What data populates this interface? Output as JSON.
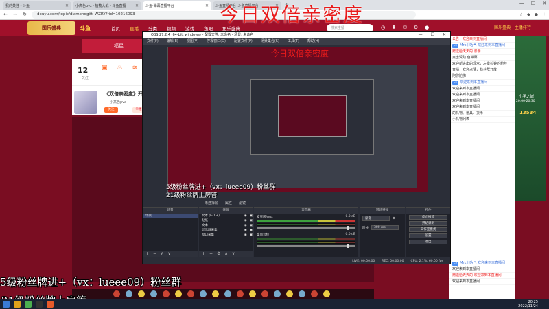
{
  "browser": {
    "tabs": [
      {
        "title": "我的关注 - 斗鱼",
        "active": false
      },
      {
        "title": "小高色pvz · 植物大战 - 斗鱼直播",
        "active": false
      },
      {
        "title": "斗鱼·弹幕直播平台",
        "active": true
      },
      {
        "title": "斗鱼直播平台_斗鱼直播平台",
        "active": false
      }
    ],
    "url": "douyu.com/topic/diamondgift_WZRY?rid=10216093",
    "window_controls": [
      "—",
      "☐",
      "✕"
    ]
  },
  "site": {
    "banner": "国乐盛典",
    "logo": "斗鱼",
    "nav": [
      "首页",
      "直播",
      "分类",
      "视频",
      "游戏",
      "鱼吧",
      "鱼乐盛典"
    ],
    "active_nav": "直播",
    "search_placeholder": "搜索主播"
  },
  "overlay": {
    "title": "今日双倍亲密度",
    "left_banner": "福星",
    "danmu_1": "5级粉丝牌进+（vx：lueee09）粉丝群",
    "danmu_2": "21级粉丝牌上房管"
  },
  "room": {
    "follow_count": "12",
    "follow_label": "关注",
    "title": "《双倍亲密度》开",
    "anchor": "小高色pvz",
    "btn_primary": "关注",
    "btn_secondary": "举报"
  },
  "obs": {
    "title": "OBS 27.2.4 (64-bit, windows) - 配置文件: 未命名 - 场景: 未命名",
    "menu": [
      "文件(F)",
      "编辑(E)",
      "视图(V)",
      "停靠窗口(D)",
      "配置文件(P)",
      "场景集合(S)",
      "工具(T)",
      "帮助(H)"
    ],
    "sub_title": "今日双倍亲密度",
    "danmu_1": "5级粉丝牌进+（vx：lueee09）粉丝群",
    "danmu_2": "21级粉丝牌上房管",
    "toolbar": [
      "未选择源",
      "属性",
      "滤镜"
    ],
    "docks": {
      "scenes": {
        "title": "场景",
        "items": [
          "场景"
        ]
      },
      "sources": {
        "title": "来源",
        "items": [
          "文本 (GDI+)",
          "贴纸",
          "文本",
          "显示器采集",
          "窗口采集"
        ]
      },
      "mixer": {
        "title": "混音器",
        "tracks": [
          {
            "name": "桌面音频",
            "level": "0.0 dB"
          },
          {
            "name": "麦克风/Aux",
            "level": "0.0 dB"
          }
        ]
      },
      "transitions": {
        "title": "转场特效",
        "type": "渐变",
        "duration_label": "时长",
        "duration": "300 ms"
      },
      "controls": {
        "title": "控件",
        "buttons": [
          "停止推流",
          "开始录制",
          "工作室模式",
          "设置",
          "退出"
        ]
      }
    },
    "status": [
      "LIVE: 00:00:00",
      "REC: 00:00:00",
      "CPU: 2.1%, 60.00 fps"
    ]
  },
  "right_panel": {
    "ad_top": "国乐盛典 · 主播排行",
    "ad_label": "小学之城",
    "ad_time": "20:00-20:30",
    "ad_number": "13534",
    "chat": [
      {
        "tag": "",
        "text": "公告：欢迎来到直播间",
        "style": "red"
      },
      {
        "tag": "Lv",
        "text": "Mrk丨咕气 欢迎来到本直播间",
        "style": "blu"
      },
      {
        "tag": "",
        "text": "赠送给天天的 亲亲",
        "style": "red"
      },
      {
        "tag": "",
        "text": "点击赞助 色弹幕",
        "style": ""
      },
      {
        "tag": "",
        "text": "欢迎新进出的观众，左键拉钟的粉丝",
        "style": ""
      },
      {
        "tag": "",
        "text": "直播，欢迎点赞，粉丝群开放",
        "style": ""
      },
      {
        "tag": "",
        "text": "阿弥陀佛",
        "style": ""
      },
      {
        "tag": "Lv",
        "text": "欢迎来到本直播间",
        "style": "blu"
      },
      {
        "tag": "",
        "text": "欢迎来到本直播间",
        "style": ""
      },
      {
        "tag": "",
        "text": "欢迎来到本直播间",
        "style": ""
      },
      {
        "tag": "",
        "text": "欢迎来到本直播间",
        "style": ""
      },
      {
        "tag": "",
        "text": "欢迎来到本直播间",
        "style": ""
      },
      {
        "tag": "",
        "text": "的礼物、道具、货币",
        "style": ""
      },
      {
        "tag": "",
        "text": "小礼物列表",
        "style": ""
      }
    ],
    "chat_bottom": [
      {
        "tag": "Lv",
        "text": "Mrk丨咕气 欢迎来到本直播间",
        "style": "blu"
      },
      {
        "tag": "",
        "text": "欢迎来到本直播间",
        "style": ""
      },
      {
        "tag": "",
        "text": "赠送给天天的 欢迎来到本直播间",
        "style": "red"
      },
      {
        "tag": "",
        "text": "欢迎来到本直播间",
        "style": ""
      }
    ]
  },
  "taskbar": {
    "time": "20:25",
    "date": "2022/11/24"
  }
}
